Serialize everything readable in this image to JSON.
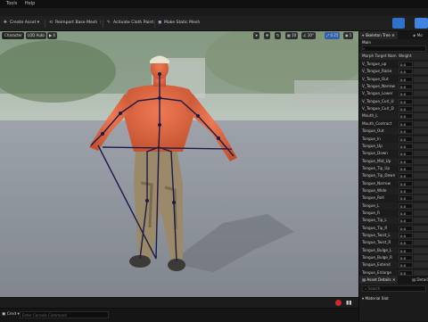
{
  "menu": [
    "Tools",
    "Help"
  ],
  "toolbar": {
    "create_asset": "Create Asset",
    "reimport": "Reimport Base Mesh",
    "activate_cloth": "Activate Cloth Paint",
    "make_static": "Make Static Mesh"
  },
  "viewport": {
    "mode_label": "Character",
    "lod_label": "LOD Auto",
    "speed": "4",
    "grid_snap": "10",
    "rot_snap": "10°",
    "scale_snap": "0.25",
    "cam_speed": "1"
  },
  "right_panel": {
    "tab_skeleton": "Skeleton Tree",
    "tab_morph": "Mo",
    "section": "Main",
    "col_name": "Morph Target Nam",
    "col_weight": "Weight",
    "morphs": [
      {
        "name": "V_Tongue_up",
        "value": "0.0"
      },
      {
        "name": "V_Tongue_Raise",
        "value": "0.0"
      },
      {
        "name": "V_Tongue_Out",
        "value": "0.0"
      },
      {
        "name": "V_Tongue_Narrow",
        "value": "0.0"
      },
      {
        "name": "V_Tongue_Lower",
        "value": "0.0"
      },
      {
        "name": "V_Tongue_Curl_U",
        "value": "0.0"
      },
      {
        "name": "V_Tongue_Curl_D",
        "value": "0.0"
      },
      {
        "name": "Mouth_L",
        "value": "0.0"
      },
      {
        "name": "Mouth_Contract",
        "value": "0.0"
      },
      {
        "name": "Tongue_Out",
        "value": "0.0"
      },
      {
        "name": "Tongue_In",
        "value": "0.0"
      },
      {
        "name": "Tongue_Up",
        "value": "0.0"
      },
      {
        "name": "Tongue_Down",
        "value": "0.0"
      },
      {
        "name": "Tongue_Mid_Up",
        "value": "0.0"
      },
      {
        "name": "Tongue_Tip_Up",
        "value": "0.0"
      },
      {
        "name": "Tongue_Tip_Down",
        "value": "0.0"
      },
      {
        "name": "Tongue_Narrow",
        "value": "0.0"
      },
      {
        "name": "Tongue_Wide",
        "value": "0.0"
      },
      {
        "name": "Tongue_Roll",
        "value": "0.0"
      },
      {
        "name": "Tongue_L",
        "value": "0.0"
      },
      {
        "name": "Tongue_R",
        "value": "0.0"
      },
      {
        "name": "Tongue_Tip_L",
        "value": "0.0"
      },
      {
        "name": "Tongue_Tip_R",
        "value": "0.0"
      },
      {
        "name": "Tongue_Twist_L",
        "value": "0.0"
      },
      {
        "name": "Tongue_Twist_R",
        "value": "0.0"
      },
      {
        "name": "Tongue_Bulge_L",
        "value": "0.0"
      },
      {
        "name": "Tongue_Bulge_R",
        "value": "0.0"
      },
      {
        "name": "Tongue_Extend",
        "value": "0.0"
      },
      {
        "name": "Tongue_Enlarge",
        "value": "0.0"
      }
    ],
    "tab_asset_details": "Asset Details",
    "tab_details": "Detail",
    "search_placeholder": "Search",
    "material_slots": "Material Slot"
  },
  "status": {
    "drawer": "Cmd",
    "console_placeholder": "Enter Console Command"
  }
}
